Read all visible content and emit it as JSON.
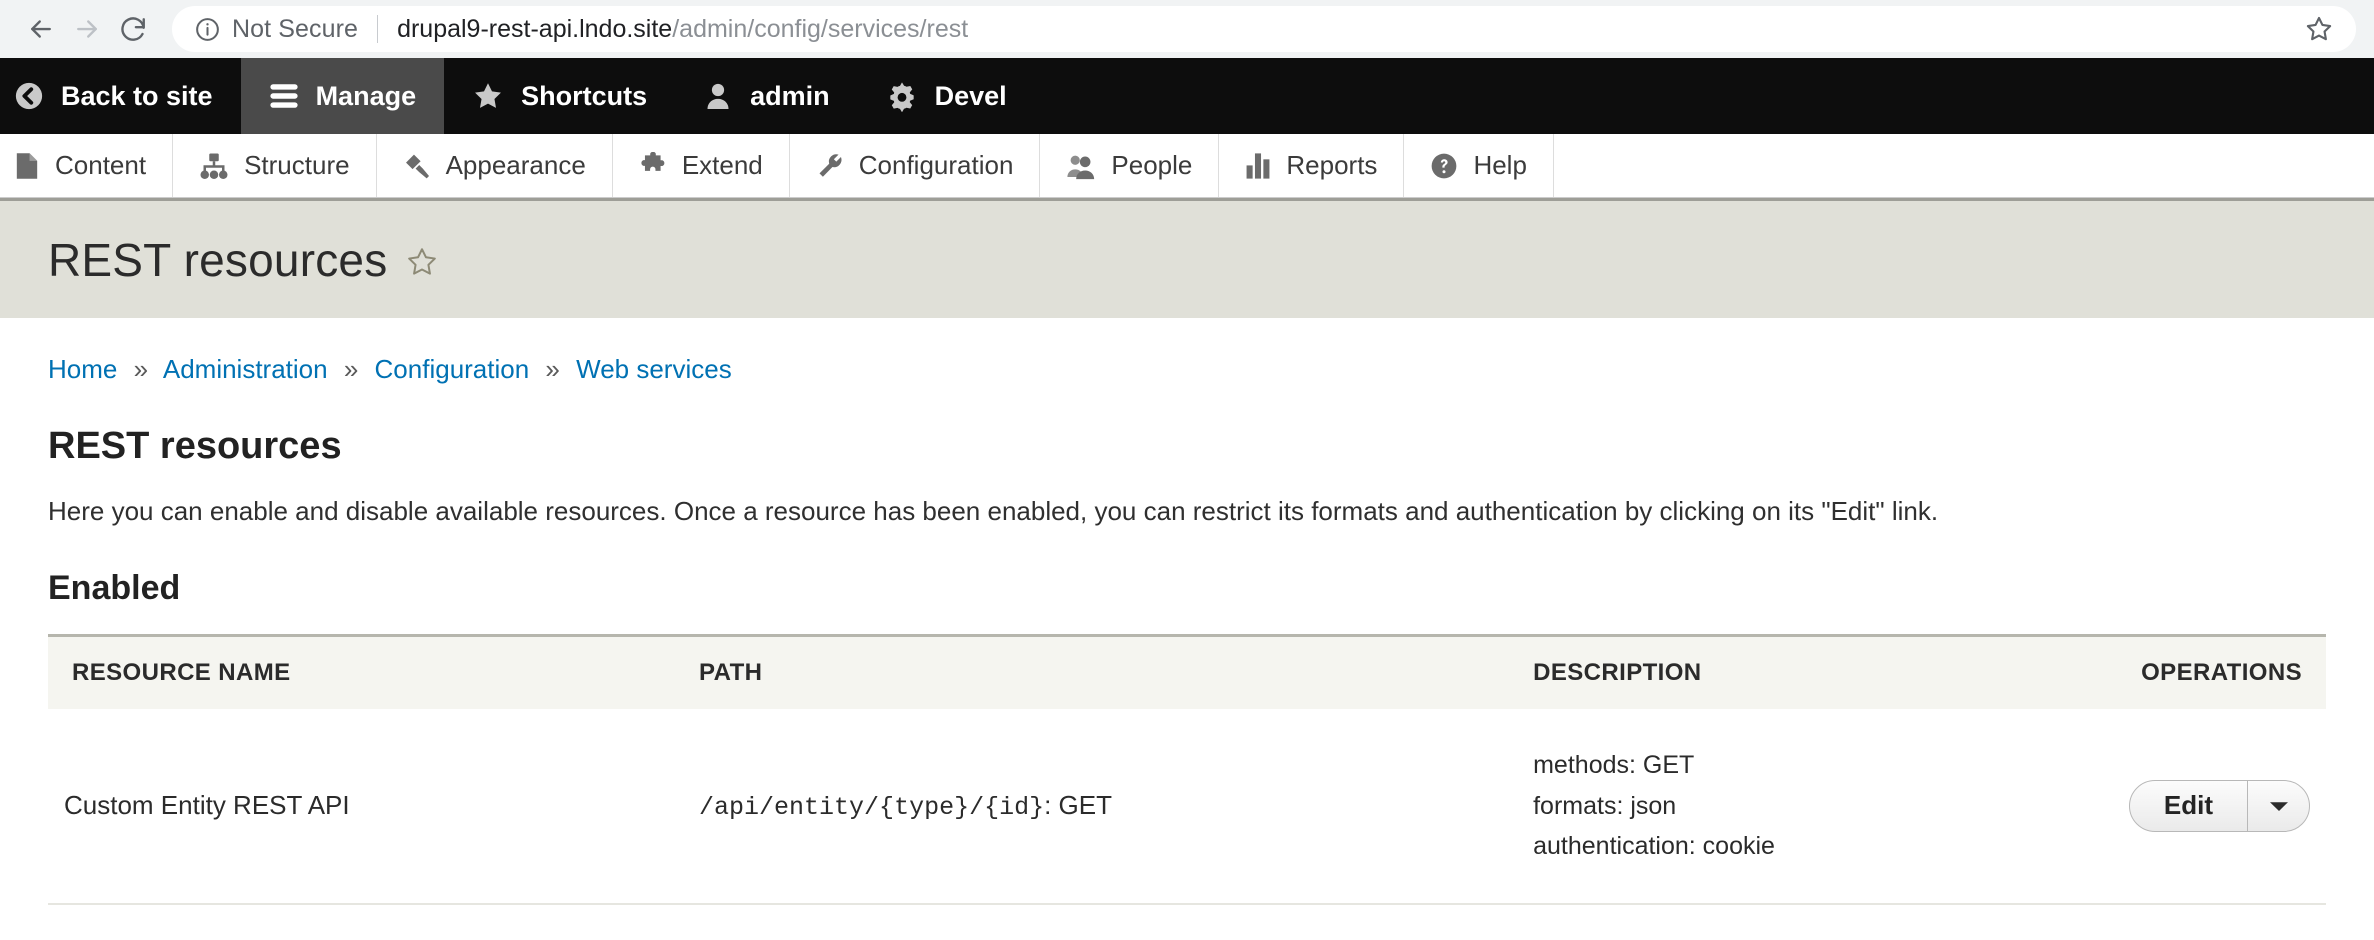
{
  "browser": {
    "back_icon": "back-arrow-icon",
    "forward_icon": "forward-arrow-icon",
    "reload_icon": "reload-icon",
    "info_icon": "info-circle-icon",
    "security_label": "Not Secure",
    "url_host": "drupal9-rest-api.lndo.site",
    "url_path": "/admin/config/services/rest",
    "bookmark_icon": "bookmark-star-icon"
  },
  "toolbar": {
    "items": [
      {
        "label": "Back to site",
        "icon": "back-circle-icon",
        "active": false
      },
      {
        "label": "Manage",
        "icon": "hamburger-icon",
        "active": true
      },
      {
        "label": "Shortcuts",
        "icon": "star-icon",
        "active": false
      },
      {
        "label": "admin",
        "icon": "user-icon",
        "active": false
      },
      {
        "label": "Devel",
        "icon": "gear-icon",
        "active": false
      }
    ]
  },
  "menu": {
    "items": [
      {
        "label": "Content",
        "icon": "file-icon"
      },
      {
        "label": "Structure",
        "icon": "hierarchy-icon"
      },
      {
        "label": "Appearance",
        "icon": "paintbrush-icon"
      },
      {
        "label": "Extend",
        "icon": "puzzle-icon"
      },
      {
        "label": "Configuration",
        "icon": "wrench-icon"
      },
      {
        "label": "People",
        "icon": "people-icon"
      },
      {
        "label": "Reports",
        "icon": "bar-chart-icon"
      },
      {
        "label": "Help",
        "icon": "question-circle-icon"
      }
    ]
  },
  "page": {
    "title": "REST resources",
    "title_star_icon": "shortcut-star-icon",
    "breadcrumb": [
      {
        "label": "Home"
      },
      {
        "label": "Administration"
      },
      {
        "label": "Configuration"
      },
      {
        "label": "Web services"
      }
    ],
    "breadcrumb_separator": "»",
    "heading": "REST resources",
    "description": "Here you can enable and disable available resources. Once a resource has been enabled, you can restrict its formats and authentication by clicking on its \"Edit\" link.",
    "enabled_heading": "Enabled"
  },
  "table": {
    "columns": {
      "name": "RESOURCE NAME",
      "path": "PATH",
      "description": "DESCRIPTION",
      "operations": "OPERATIONS"
    },
    "rows": [
      {
        "name": "Custom Entity REST API",
        "path": "/api/entity/{type}/{id}",
        "path_methods": ": GET",
        "methods": "methods: GET",
        "formats": "formats: json",
        "authentication": "authentication: cookie",
        "operation_label": "Edit",
        "operation_toggle_icon": "chevron-down-icon"
      }
    ]
  },
  "colors": {
    "toolbar_bg": "#0d0d0d",
    "toolbar_active_bg": "#4a4a4a",
    "title_bg": "#e0e0d8",
    "link": "#0071b3",
    "table_header_bg": "#f5f5f0"
  }
}
